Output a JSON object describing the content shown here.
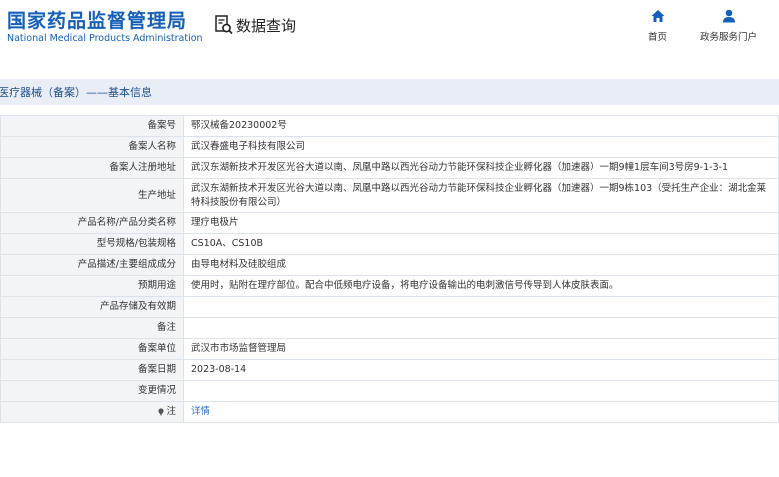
{
  "header": {
    "logo_cn": "国家药品监督管理局",
    "logo_en": "National Medical Products Administration",
    "query_label": "数据查询",
    "nav_home": "首页",
    "nav_gov": "政务服务门户"
  },
  "breadcrumb": "医疗器械（备案）——基本信息",
  "rows": [
    {
      "key": "备案号",
      "value": "鄂汉械备20230002号"
    },
    {
      "key": "备案人名称",
      "value": "武汉春盛电子科技有限公司"
    },
    {
      "key": "备案人注册地址",
      "value": "武汉东湖新技术开发区光谷大道以南、凤凰中路以西光谷动力节能环保科技企业孵化器（加速器）一期9幢1层车间3号房9-1-3-1"
    },
    {
      "key": "生产地址",
      "value": "武汉东湖新技术开发区光谷大道以南、凤凰中路以西光谷动力节能环保科技企业孵化器（加速器）一期9栋103（受托生产企业：湖北金莱特科技股份有限公司）"
    },
    {
      "key": "产品名称/产品分类名称",
      "value": "理疗电极片"
    },
    {
      "key": "型号规格/包装规格",
      "value": "CS10A、CS10B"
    },
    {
      "key": "产品描述/主要组成成分",
      "value": "由导电材料及硅胶组成"
    },
    {
      "key": "预期用途",
      "value": "使用时，贴附在理疗部位。配合中低频电疗设备，将电疗设备输出的电刺激信号传导到人体皮肤表面。"
    },
    {
      "key": "产品存储及有效期",
      "value": ""
    },
    {
      "key": "备注",
      "value": ""
    },
    {
      "key": "备案单位",
      "value": "武汉市市场监督管理局"
    },
    {
      "key": "备案日期",
      "value": "2023-08-14"
    },
    {
      "key": "变更情况",
      "value": ""
    }
  ],
  "note": {
    "key": "注",
    "link": "详情",
    "icon": "pin-icon"
  },
  "colors": {
    "brand": "#1560b8",
    "crumb_bg": "#e9eef6",
    "key_bg": "#f2f4f7",
    "link": "#2a6fc5"
  }
}
